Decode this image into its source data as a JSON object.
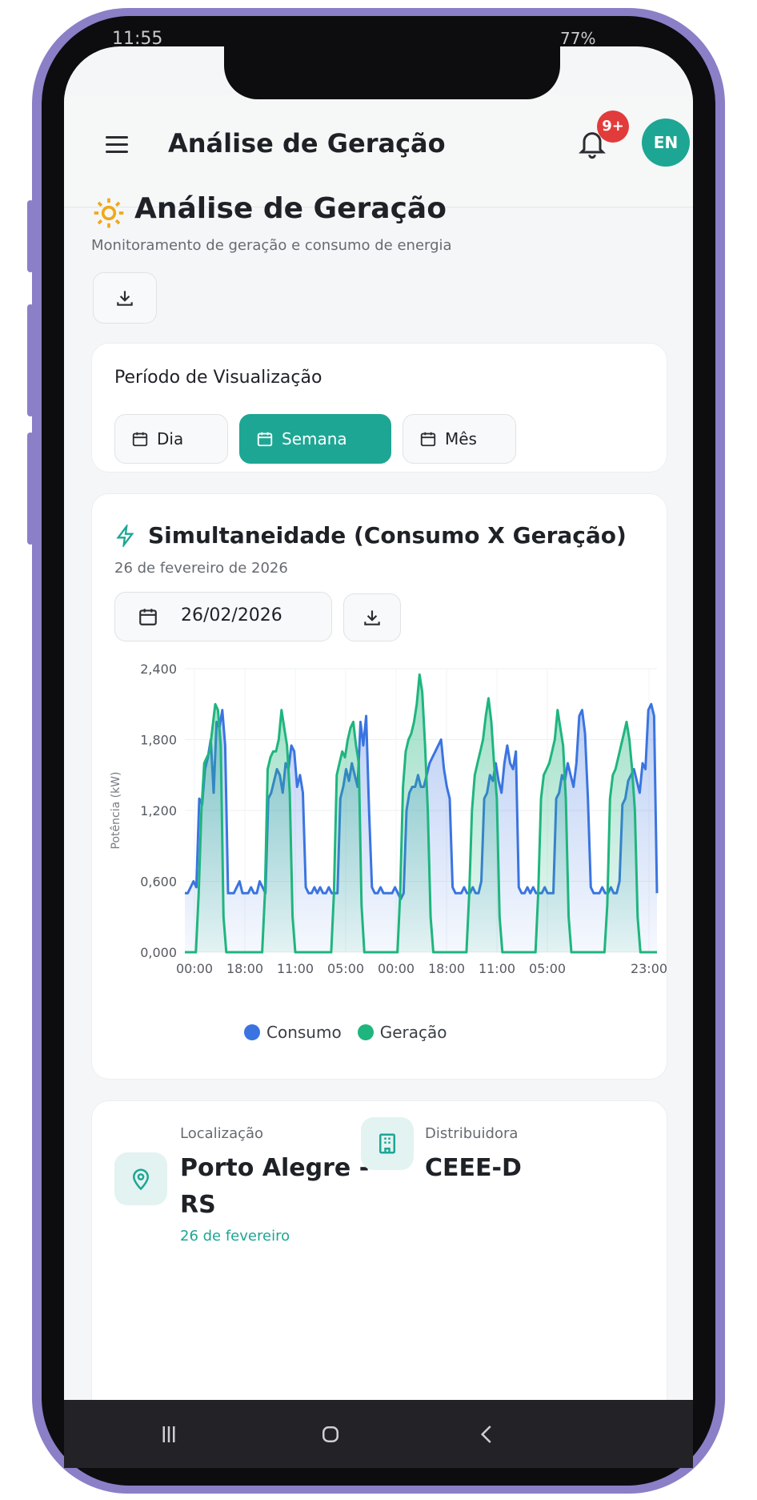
{
  "status_bar": {
    "time": "11:55",
    "battery": "77%"
  },
  "app_bar": {
    "title": "Análise de Geração",
    "notification_badge": "9+",
    "avatar_initials": "EN",
    "brand_color": "#1ea694"
  },
  "page": {
    "title": "Análise de Geração",
    "subtitle": "Monitoramento de geração e consumo de energia"
  },
  "period": {
    "label": "Período de Visualização",
    "options": [
      "Dia",
      "Semana",
      "Mês"
    ],
    "selected": "Semana"
  },
  "simultaneity": {
    "title": "Simultaneidade (Consumo X Geração)",
    "date_caption": "26 de fevereiro de 2026",
    "date_value": "26/02/2026"
  },
  "chart_data": {
    "type": "area",
    "ylabel": "Potência (kW)",
    "ylim": [
      0,
      2.4
    ],
    "y_ticks": [
      "0,000",
      "0,600",
      "1,200",
      "1,800",
      "2,400"
    ],
    "x_tick_labels": [
      "00:00",
      "18:00",
      "11:00",
      "05:00",
      "00:00",
      "18:00",
      "11:00",
      "05:00",
      "23:00"
    ],
    "grid": true,
    "legend_position": "bottom",
    "series": [
      {
        "name": "Consumo",
        "color": "#3b74e0",
        "values": [
          0.5,
          0.5,
          0.55,
          0.6,
          0.55,
          1.3,
          1.25,
          1.55,
          1.65,
          1.8,
          1.35,
          1.95,
          1.9,
          2.05,
          1.75,
          0.5,
          0.5,
          0.5,
          0.55,
          0.6,
          0.5,
          0.5,
          0.5,
          0.55,
          0.5,
          0.5,
          0.6,
          0.55,
          0.5,
          1.3,
          1.35,
          1.45,
          1.55,
          1.5,
          1.35,
          1.6,
          1.55,
          1.75,
          1.7,
          1.4,
          1.5,
          1.35,
          0.55,
          0.5,
          0.5,
          0.55,
          0.5,
          0.55,
          0.5,
          0.5,
          0.55,
          0.5,
          0.5,
          0.5,
          1.3,
          1.4,
          1.55,
          1.45,
          1.6,
          1.5,
          1.4,
          1.95,
          1.75,
          2.0,
          1.2,
          0.55,
          0.5,
          0.5,
          0.55,
          0.5,
          0.5,
          0.5,
          0.5,
          0.55,
          0.5,
          0.45,
          0.5,
          1.2,
          1.35,
          1.4,
          1.4,
          1.5,
          1.4,
          1.4,
          1.5,
          1.6,
          1.65,
          1.7,
          1.75,
          1.8,
          1.55,
          1.4,
          1.3,
          0.55,
          0.5,
          0.5,
          0.5,
          0.55,
          0.5,
          0.5,
          0.55,
          0.5,
          0.5,
          0.6,
          1.3,
          1.35,
          1.5,
          1.45,
          1.6,
          1.45,
          1.35,
          1.6,
          1.75,
          1.6,
          1.55,
          1.7,
          0.55,
          0.5,
          0.5,
          0.55,
          0.5,
          0.55,
          0.5,
          0.5,
          0.5,
          0.55,
          0.5,
          0.5,
          0.5,
          1.3,
          1.35,
          1.5,
          1.45,
          1.6,
          1.5,
          1.4,
          1.6,
          2.0,
          2.05,
          1.85,
          1.3,
          0.55,
          0.5,
          0.5,
          0.5,
          0.55,
          0.5,
          0.5,
          0.55,
          0.5,
          0.5,
          0.6,
          1.25,
          1.3,
          1.45,
          1.5,
          1.55,
          1.45,
          1.35,
          1.6,
          1.55,
          2.05,
          2.1,
          2.0,
          0.5
        ]
      },
      {
        "name": "Geração",
        "color": "#1fb57e",
        "values": [
          0,
          0,
          0,
          0,
          0,
          0.5,
          1.2,
          1.6,
          1.65,
          1.7,
          1.9,
          2.1,
          2.05,
          1.75,
          0.3,
          0,
          0,
          0,
          0,
          0,
          0,
          0,
          0,
          0,
          0,
          0,
          0,
          0,
          0,
          0.5,
          1.55,
          1.65,
          1.7,
          1.7,
          1.8,
          2.05,
          1.9,
          1.75,
          1.35,
          0.3,
          0,
          0,
          0,
          0,
          0,
          0,
          0,
          0,
          0,
          0,
          0,
          0,
          0,
          0,
          0.5,
          1.5,
          1.6,
          1.7,
          1.65,
          1.8,
          1.9,
          1.95,
          1.75,
          1.6,
          0.4,
          0,
          0,
          0,
          0,
          0,
          0,
          0,
          0,
          0,
          0,
          0,
          0,
          0,
          0.5,
          1.4,
          1.7,
          1.8,
          1.85,
          1.95,
          2.1,
          2.35,
          2.2,
          1.75,
          1.2,
          0.3,
          0,
          0,
          0,
          0,
          0,
          0,
          0,
          0,
          0,
          0,
          0,
          0,
          0,
          0.5,
          1.2,
          1.5,
          1.6,
          1.7,
          1.8,
          2.0,
          2.15,
          1.95,
          1.6,
          1.3,
          0.3,
          0,
          0,
          0,
          0,
          0,
          0,
          0,
          0,
          0,
          0,
          0,
          0,
          0,
          0.5,
          1.3,
          1.5,
          1.55,
          1.6,
          1.7,
          1.8,
          2.05,
          1.9,
          1.75,
          1.3,
          0.3,
          0,
          0,
          0,
          0,
          0,
          0,
          0,
          0,
          0,
          0,
          0,
          0,
          0,
          0.4,
          1.3,
          1.5,
          1.55,
          1.65,
          1.75,
          1.85,
          1.95,
          1.8,
          1.55,
          1.2,
          0.3,
          0,
          0,
          0,
          0,
          0,
          0,
          0
        ]
      }
    ]
  },
  "info": {
    "location_label": "Localização",
    "location_value_line1": "Porto Alegre -",
    "location_value_line2": "RS",
    "location_date": "26 de fevereiro",
    "distributor_label": "Distribuidora",
    "distributor_value": "CEEE-D"
  }
}
